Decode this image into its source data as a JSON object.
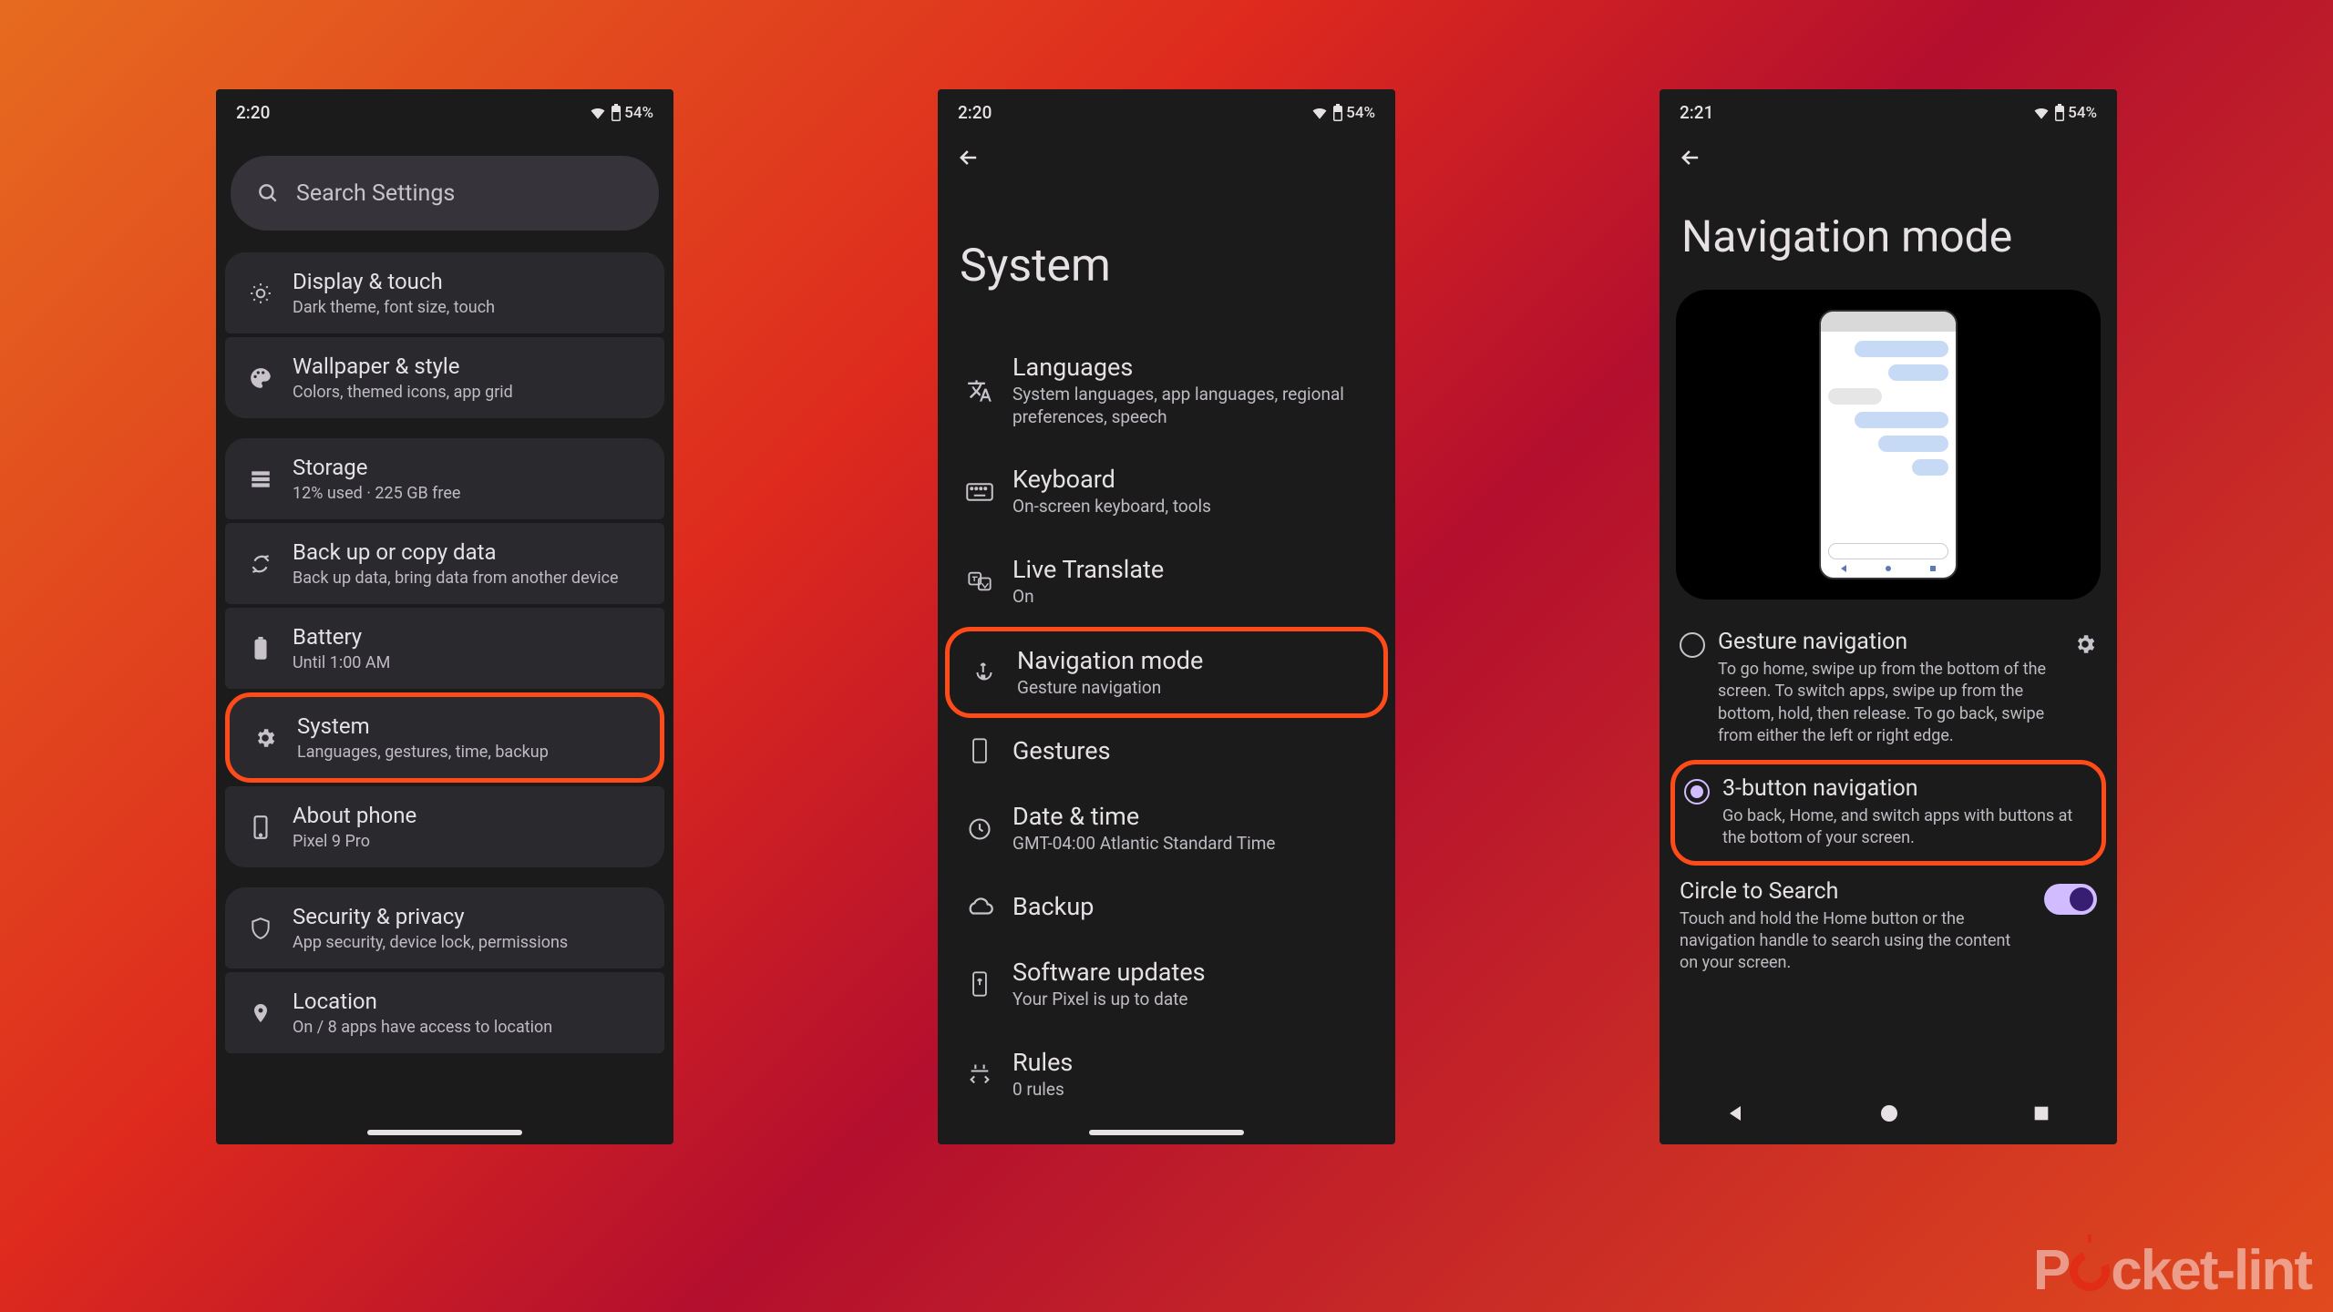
{
  "status": {
    "time1": "2:20",
    "time2": "2:20",
    "time3": "2:21",
    "battery": "54%"
  },
  "screen1": {
    "search": "Search Settings",
    "rows": [
      {
        "title": "Display & touch",
        "sub": "Dark theme, font size, touch"
      },
      {
        "title": "Wallpaper & style",
        "sub": "Colors, themed icons, app grid"
      },
      {
        "title": "Storage",
        "sub": "12% used · 225 GB free"
      },
      {
        "title": "Back up or copy data",
        "sub": "Back up data, bring data from another device"
      },
      {
        "title": "Battery",
        "sub": "Until 1:00 AM"
      },
      {
        "title": "System",
        "sub": "Languages, gestures, time, backup"
      },
      {
        "title": "About phone",
        "sub": "Pixel 9 Pro"
      },
      {
        "title": "Security & privacy",
        "sub": "App security, device lock, permissions"
      },
      {
        "title": "Location",
        "sub": "On / 8 apps have access to location"
      }
    ]
  },
  "screen2": {
    "title": "System",
    "rows": [
      {
        "title": "Languages",
        "sub": "System languages, app languages, regional preferences, speech"
      },
      {
        "title": "Keyboard",
        "sub": "On-screen keyboard, tools"
      },
      {
        "title": "Live Translate",
        "sub": "On"
      },
      {
        "title": "Navigation mode",
        "sub": "Gesture navigation"
      },
      {
        "title": "Gestures",
        "sub": ""
      },
      {
        "title": "Date & time",
        "sub": "GMT-04:00 Atlantic Standard Time"
      },
      {
        "title": "Backup",
        "sub": ""
      },
      {
        "title": "Software updates",
        "sub": "Your Pixel is up to date"
      },
      {
        "title": "Rules",
        "sub": "0 rules"
      }
    ]
  },
  "screen3": {
    "title": "Navigation mode",
    "opt1": {
      "title": "Gesture navigation",
      "sub": "To go home, swipe up from the bottom of the screen. To switch apps, swipe up from the bottom, hold, then release. To go back, swipe from either the left or right edge."
    },
    "opt2": {
      "title": "3-button navigation",
      "sub": "Go back, Home, and switch apps with buttons at the bottom of your screen."
    },
    "cts": {
      "title": "Circle to Search",
      "sub": "Touch and hold the Home button or the navigation handle to search using the content on your screen."
    }
  },
  "watermark": "Pocket-lint"
}
